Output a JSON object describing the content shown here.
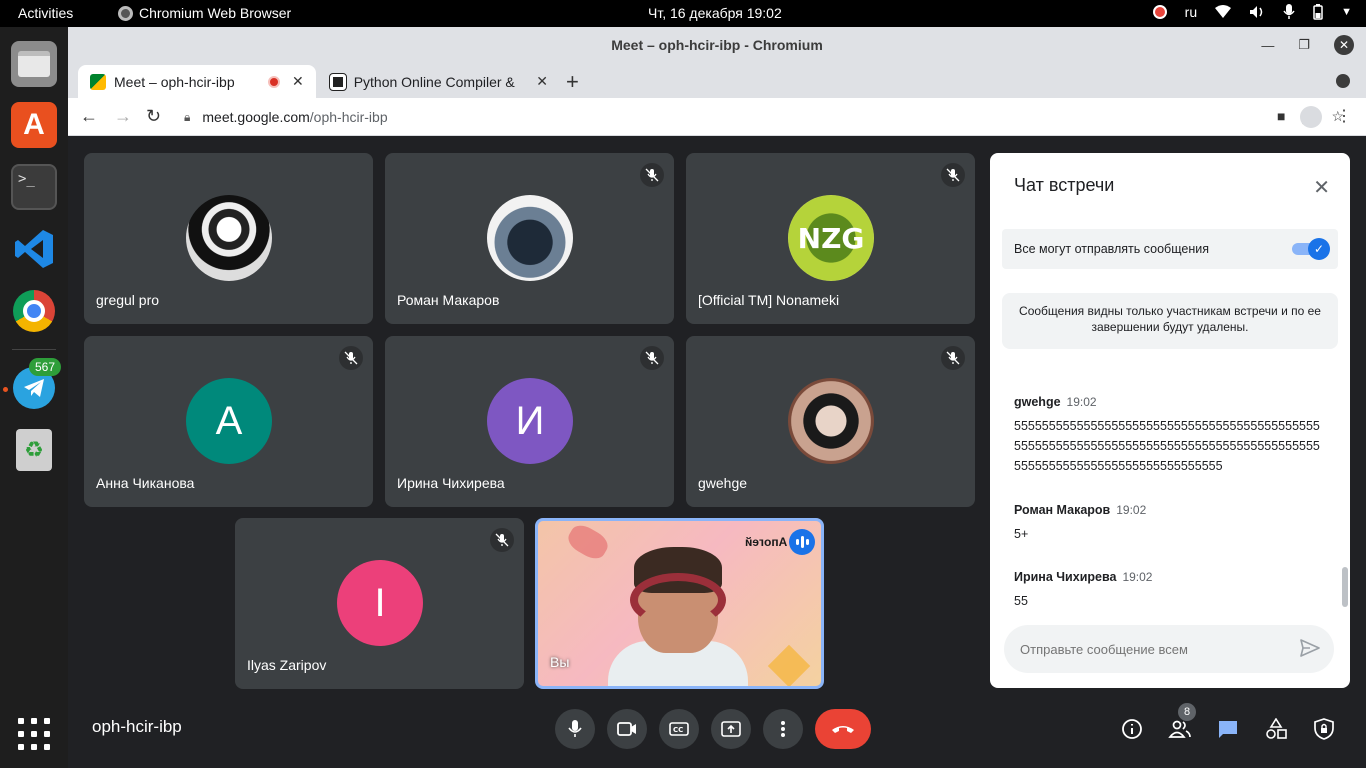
{
  "topbar": {
    "activities": "Activities",
    "app_name": "Chromium Web Browser",
    "clock": "Чт, 16 декабря  19:02",
    "lang": "ru"
  },
  "dock": {
    "telegram_badge": "567"
  },
  "window": {
    "title": "Meet – oph-hcir-ibp - Chromium"
  },
  "tabs": [
    {
      "label": "Meet – oph-hcir-ibp"
    },
    {
      "label": "Python Online Compiler & "
    }
  ],
  "address": {
    "host": "meet.google.com",
    "path": "/oph-hcir-ibp"
  },
  "participants": [
    {
      "name": "gregul pro",
      "avatar": ""
    },
    {
      "name": "Роман Макаров",
      "avatar": ""
    },
    {
      "name": "[Official TM] Nonameki",
      "avatar": "NZG"
    },
    {
      "name": "Анна Чиканова",
      "avatar": "А",
      "color": "#00897b"
    },
    {
      "name": "Ирина Чихирева",
      "avatar": "И",
      "color": "#7e57c2"
    },
    {
      "name": "gwehge",
      "avatar": ""
    },
    {
      "name": "Ilyas Zaripov",
      "avatar": "I",
      "color": "#ec407a"
    }
  ],
  "self_tile": {
    "label": "Вы",
    "brand": "Апогей"
  },
  "chat": {
    "title": "Чат встречи",
    "permission_label": "Все могут отправлять сообщения",
    "permission_on": true,
    "notice": "Сообщения видны только участникам встречи и по ее завершении будут удалены.",
    "messages": [
      {
        "author": "gwehge",
        "time": "19:02",
        "text": "5555555555555555555555555555555555555555555555555555555555555555555555555555555555555555555555555555555555555555555555"
      },
      {
        "author": "Роман Макаров",
        "time": "19:02",
        "text": "5+"
      },
      {
        "author": "Ирина Чихирева",
        "time": "19:02",
        "text": "55"
      }
    ],
    "input_placeholder": "Отправьте сообщение всем"
  },
  "meeting": {
    "code": "oph-hcir-ibp",
    "participant_count": "8"
  },
  "colors": {
    "accent": "#1a73e8",
    "end_call": "#ea4335",
    "background": "#202124"
  }
}
